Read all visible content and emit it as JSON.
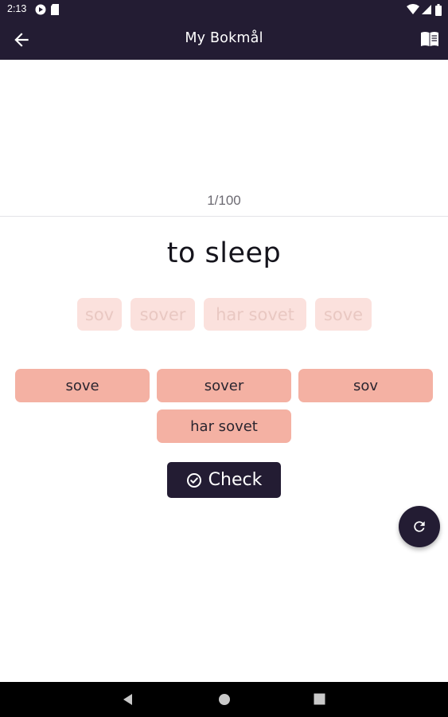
{
  "status_bar": {
    "time": "2:13",
    "icons": [
      "google-play-icon",
      "sd-card-icon",
      "wifi-icon",
      "signal-icon",
      "battery-icon"
    ]
  },
  "app_bar": {
    "title": "My Bokmål",
    "back_icon": "arrow-left-icon",
    "action_icon": "book-icon"
  },
  "progress": {
    "text": "1/100"
  },
  "prompt": {
    "text": "to sleep"
  },
  "answer_slots": [
    "sov",
    "sover",
    "har sovet",
    "sove"
  ],
  "options": [
    "sove",
    "sover",
    "sov",
    "har sovet"
  ],
  "check_button": {
    "label": "Check",
    "icon": "check-circle-icon"
  },
  "fab": {
    "icon": "refresh-icon"
  },
  "navigation": {
    "icons": [
      "back-triangle-icon",
      "home-circle-icon",
      "recents-square-icon"
    ]
  },
  "colors": {
    "primary": "#231c33",
    "option_bg": "#f4b1a3",
    "slot_bg": "#fbe1dd",
    "slot_text": "#e9c8c2"
  }
}
